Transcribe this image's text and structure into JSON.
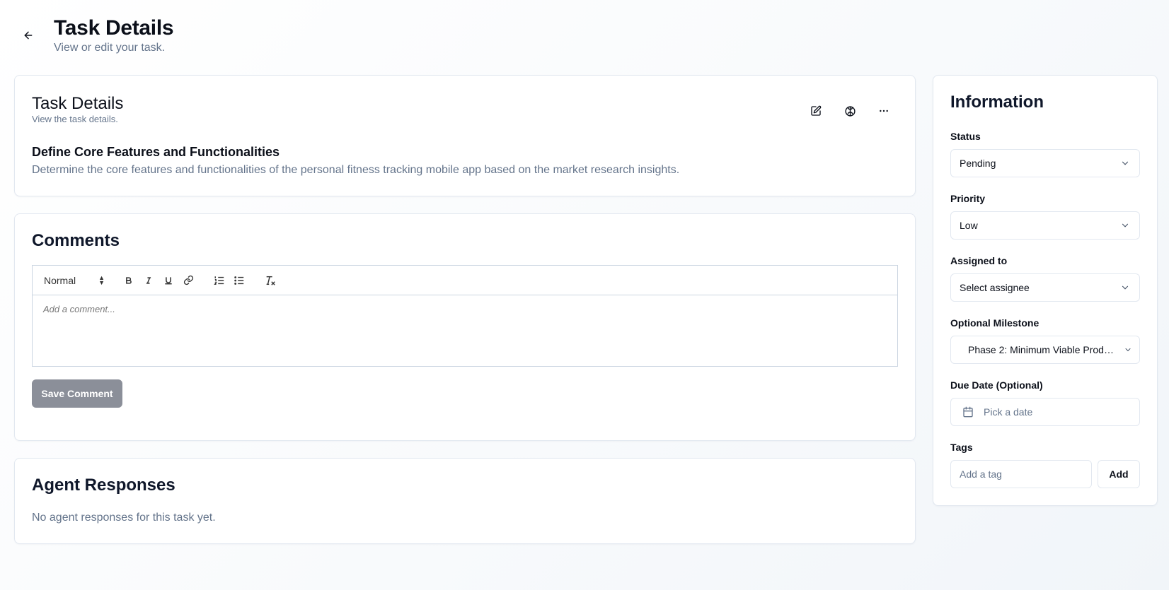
{
  "header": {
    "title": "Task Details",
    "subtitle": "View or edit your task.",
    "back_icon": "arrow-left-icon"
  },
  "details_card": {
    "title": "Task Details",
    "subtitle": "View the task details.",
    "actions": [
      "edit-icon",
      "brain-icon",
      "more-horizontal-icon"
    ],
    "task_name": "Define Core Features and Functionalities",
    "task_description": "Determine the core features and functionalities of the personal fitness tracking mobile app based on the market research insights."
  },
  "comments_card": {
    "title": "Comments",
    "toolbar": {
      "format_value": "Normal",
      "bold": "B",
      "italic": "I",
      "underline": "U",
      "clean": "Tx"
    },
    "placeholder": "Add a comment...",
    "save_label": "Save Comment"
  },
  "agent_card": {
    "title": "Agent Responses",
    "empty_text": "No agent responses for this task yet."
  },
  "info_card": {
    "title": "Information",
    "status": {
      "label": "Status",
      "value": "Pending"
    },
    "priority": {
      "label": "Priority",
      "value": "Low"
    },
    "assigned": {
      "label": "Assigned to",
      "value": "Select assignee"
    },
    "milestone": {
      "label": "Optional Milestone",
      "value": "Phase 2: Minimum Viable Product..."
    },
    "due_date": {
      "label": "Due Date (Optional)",
      "placeholder": "Pick a date"
    },
    "tags": {
      "label": "Tags",
      "placeholder": "Add a tag",
      "add_label": "Add"
    }
  },
  "colors": {
    "text_primary": "#0b0f19",
    "text_muted": "#64748b",
    "border": "#e2e8f0",
    "save_button_bg": "#8b8f99"
  }
}
